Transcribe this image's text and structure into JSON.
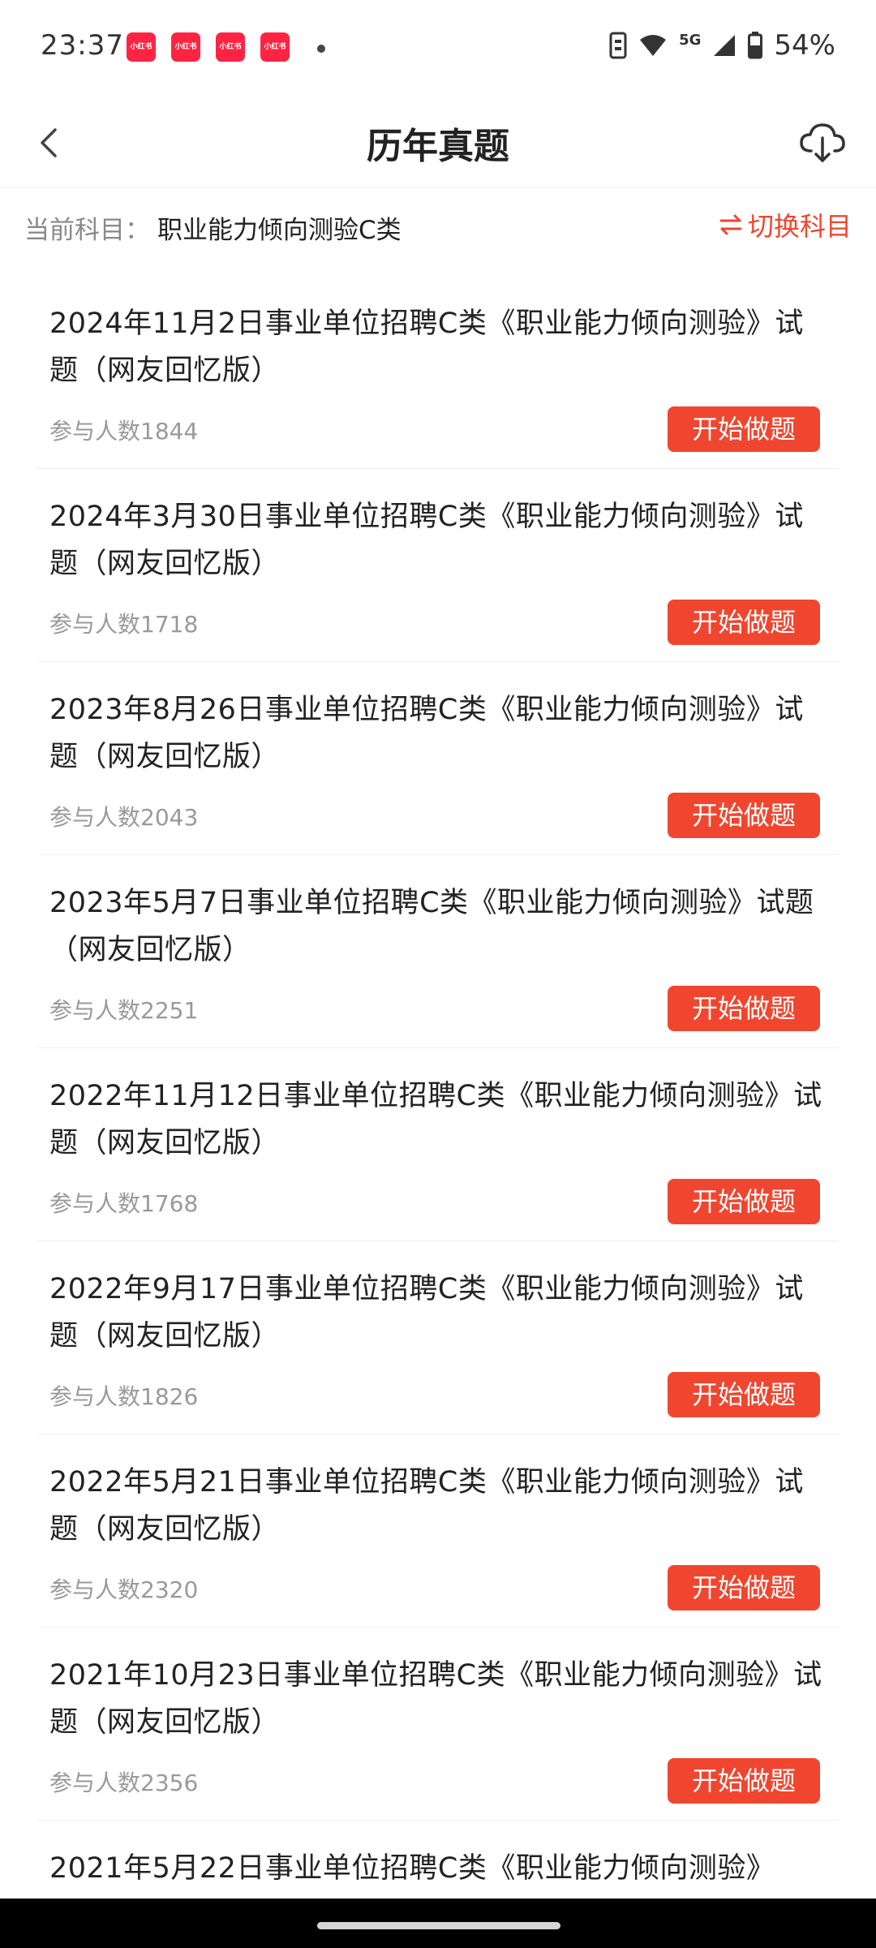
{
  "status_bar": {
    "time": "23:37",
    "notification_icons": [
      "小红书",
      "小红书",
      "小红书",
      "小红书"
    ],
    "network": "5G",
    "battery": "54%"
  },
  "nav": {
    "title": "历年真题",
    "back_icon": "back-chevron-icon",
    "download_icon": "cloud-download-icon"
  },
  "subject": {
    "label": "当前科目：",
    "name": "职业能力倾向测验C类",
    "switch_label": "切换科目"
  },
  "exams": [
    {
      "title": "2024年11月2日事业单位招聘C类《职业能力倾向测验》试题（网友回忆版）",
      "count": "参与人数1844",
      "button": "开始做题"
    },
    {
      "title": "2024年3月30日事业单位招聘C类《职业能力倾向测验》试题（网友回忆版）",
      "count": "参与人数1718",
      "button": "开始做题"
    },
    {
      "title": "2023年8月26日事业单位招聘C类《职业能力倾向测验》试题（网友回忆版）",
      "count": "参与人数2043",
      "button": "开始做题"
    },
    {
      "title": "2023年5月7日事业单位招聘C类《职业能力倾向测验》试题（网友回忆版）",
      "count": "参与人数2251",
      "button": "开始做题"
    },
    {
      "title": "2022年11月12日事业单位招聘C类《职业能力倾向测验》试题（网友回忆版）",
      "count": "参与人数1768",
      "button": "开始做题"
    },
    {
      "title": "2022年9月17日事业单位招聘C类《职业能力倾向测验》试题（网友回忆版）",
      "count": "参与人数1826",
      "button": "开始做题"
    },
    {
      "title": "2022年5月21日事业单位招聘C类《职业能力倾向测验》试题（网友回忆版）",
      "count": "参与人数2320",
      "button": "开始做题"
    },
    {
      "title": "2021年10月23日事业单位招聘C类《职业能力倾向测验》试题（网友回忆版）",
      "count": "参与人数2356",
      "button": "开始做题"
    },
    {
      "title": "2021年5月22日事业单位招聘C类《职业能力倾向测验》",
      "count": "",
      "button": ""
    }
  ],
  "colors": {
    "accent": "#f0462f",
    "muted_text": "#999999",
    "brand_notification": "#ff2442"
  }
}
